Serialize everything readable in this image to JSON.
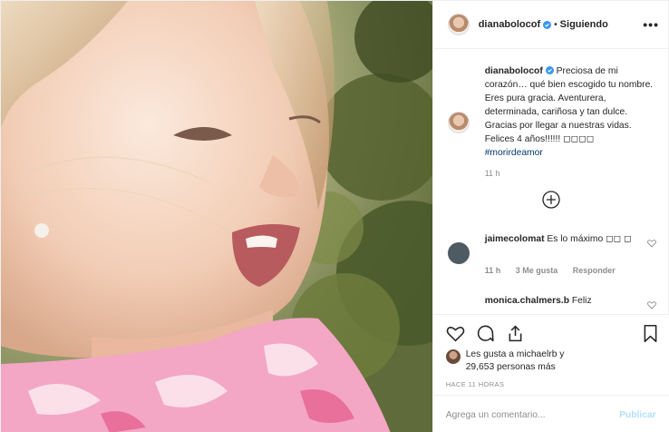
{
  "header": {
    "username": "dianabolocof",
    "separator": "•",
    "follow_status": "Siguiendo",
    "more": "•••"
  },
  "caption": {
    "username": "dianabolocof",
    "text": "Preciosa de mi corazón… qué bien escogido tu nombre. Eres pura gracia. Aventurera, determinada, cariñosa y tan dulce. Gracias por llegar a nuestras vidas. Felices 4 años!!!!!! ◻◻◻◻",
    "hashtag": "#morirdeamor",
    "time": "11 h"
  },
  "comments": [
    {
      "username": "jaimecolomat",
      "text": "Es lo máximo ◻◻ ◻",
      "time": "11 h",
      "likes": "3 Me gusta",
      "reply": "Responder"
    },
    {
      "username": "monica.chalmers.b",
      "text": "Feliz"
    }
  ],
  "likes": {
    "line1": "Les gusta a michaelrb y",
    "line2": "29,653 personas más"
  },
  "post_time": "HACE 11 HORAS",
  "add_comment": {
    "placeholder": "Agrega un comentario...",
    "publish": "Publicar"
  },
  "icons": {
    "verified": "verified-badge-icon",
    "add": "add-circle-icon",
    "like": "heart-icon",
    "comment": "comment-icon",
    "share": "share-icon",
    "save": "bookmark-icon"
  },
  "colors": {
    "verified": "#3897f0",
    "link": "#00376b",
    "muted": "#8e8e8e",
    "publish": "#b2dffc"
  }
}
